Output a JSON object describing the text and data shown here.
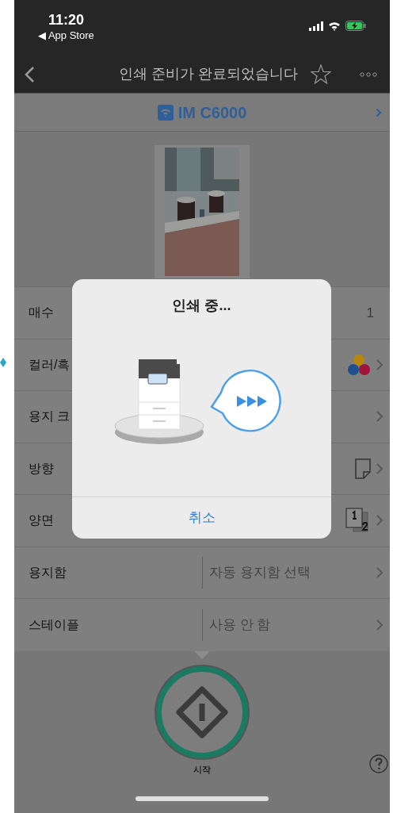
{
  "status_bar": {
    "time": "11:20",
    "back_app": "◀ App Store"
  },
  "nav": {
    "title": "인쇄 준비가 완료되었습니다"
  },
  "printer": {
    "name": "IM C6000"
  },
  "rows": [
    {
      "label": "매수",
      "kind": "count",
      "value": "1"
    },
    {
      "label": "컬러/흑",
      "kind": "color"
    },
    {
      "label": "용지 크",
      "kind": "plain"
    },
    {
      "label": "방향",
      "kind": "orientation"
    },
    {
      "label": "양면",
      "kind": "duplex"
    },
    {
      "label": "용지함",
      "kind": "text",
      "value": "자동 용지함 선택"
    },
    {
      "label": "스테이플",
      "kind": "text",
      "value": "사용 안 함"
    }
  ],
  "dialog": {
    "title": "인쇄 중...",
    "cancel": "취소"
  },
  "start": {
    "label": "시작"
  }
}
